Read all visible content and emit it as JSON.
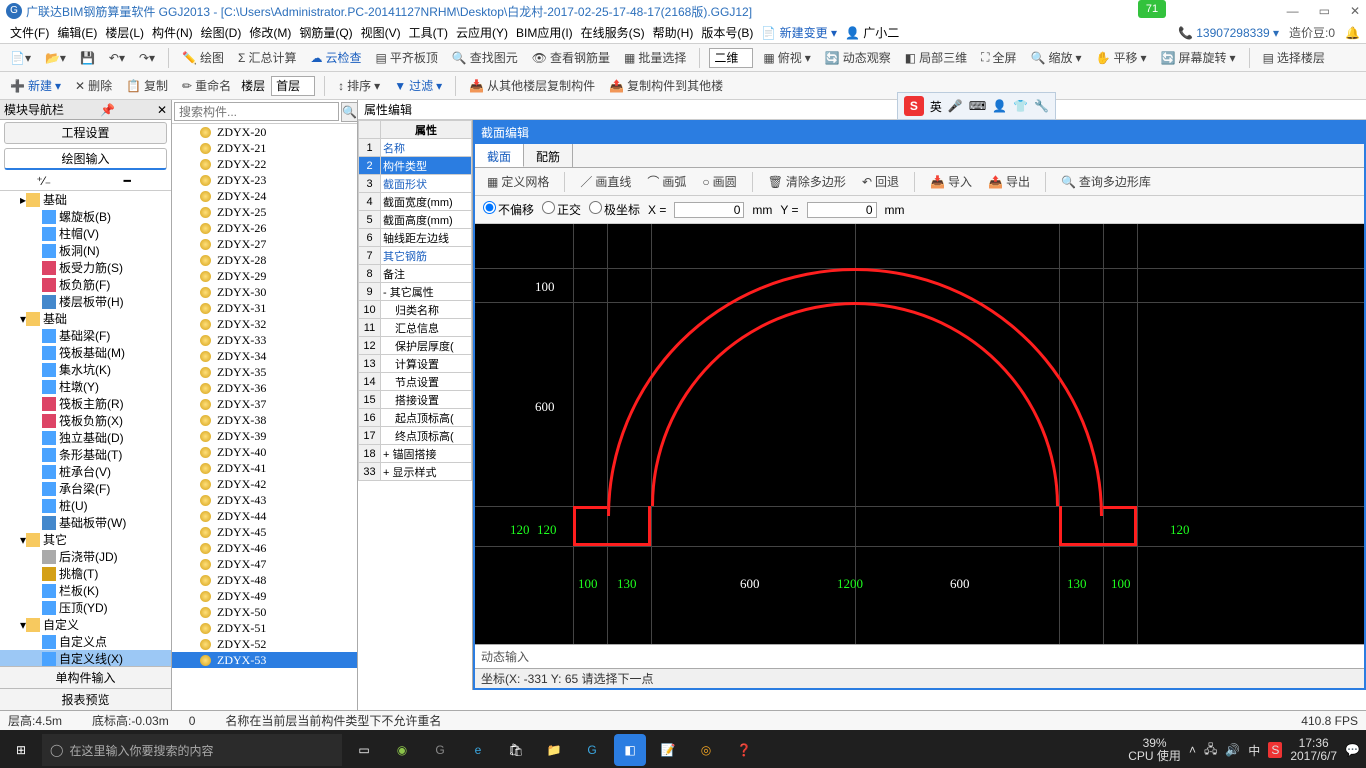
{
  "title": "广联达BIM钢筋算量软件 GGJ2013 - [C:\\Users\\Administrator.PC-20141127NRHM\\Desktop\\白龙村-2017-02-25-17-48-17(2168版).GGJ12]",
  "badge_num": "71",
  "menu": [
    "文件(F)",
    "编辑(E)",
    "楼层(L)",
    "构件(N)",
    "绘图(D)",
    "修改(M)",
    "钢筋量(Q)",
    "视图(V)",
    "工具(T)",
    "云应用(Y)",
    "BIM应用(I)",
    "在线服务(S)",
    "帮助(H)",
    "版本号(B)"
  ],
  "menu_right": {
    "new_change": "新建变更",
    "user": "广小二",
    "phone": "13907298339",
    "beans": "造价豆:0"
  },
  "toolbar1": [
    "绘图",
    "汇总计算",
    "云检查",
    "平齐板顶",
    "查找图元",
    "查看钢筋量",
    "批量选择",
    "二维",
    "俯视",
    "动态观察",
    "局部三维",
    "全屏",
    "缩放",
    "平移",
    "屏幕旋转",
    "选择楼层"
  ],
  "toolbar2": {
    "new": "新建",
    "del": "删除",
    "copy": "复制",
    "rename": "重命名",
    "floor_lbl": "楼层",
    "floor": "首层",
    "sort": "排序",
    "filter": "过滤",
    "copy_from": "从其他楼层复制构件",
    "copy_to": "复制构件到其他楼"
  },
  "sogou": "英",
  "nav_header": "模块导航栏",
  "nav_tab1": "工程设置",
  "nav_tab2": "绘图输入",
  "tree_groups": [
    {
      "label": "基础",
      "children": [
        {
          "l": "螺旋板(B)",
          "c": "#4aa3ff"
        },
        {
          "l": "柱帽(V)",
          "c": "#4aa3ff"
        },
        {
          "l": "板洞(N)",
          "c": "#4aa3ff"
        },
        {
          "l": "板受力筋(S)",
          "c": "#d46"
        },
        {
          "l": "板负筋(F)",
          "c": "#d46"
        },
        {
          "l": "楼层板带(H)",
          "c": "#48c"
        }
      ]
    },
    {
      "label": "基础",
      "open": true,
      "children": [
        {
          "l": "基础梁(F)",
          "c": "#4aa3ff"
        },
        {
          "l": "筏板基础(M)",
          "c": "#4aa3ff"
        },
        {
          "l": "集水坑(K)",
          "c": "#4aa3ff"
        },
        {
          "l": "柱墩(Y)",
          "c": "#4aa3ff"
        },
        {
          "l": "筏板主筋(R)",
          "c": "#d46"
        },
        {
          "l": "筏板负筋(X)",
          "c": "#d46"
        },
        {
          "l": "独立基础(D)",
          "c": "#4aa3ff"
        },
        {
          "l": "条形基础(T)",
          "c": "#4aa3ff"
        },
        {
          "l": "桩承台(V)",
          "c": "#4aa3ff"
        },
        {
          "l": "承台梁(F)",
          "c": "#4aa3ff"
        },
        {
          "l": "桩(U)",
          "c": "#4aa3ff"
        },
        {
          "l": "基础板带(W)",
          "c": "#48c"
        }
      ]
    },
    {
      "label": "其它",
      "open": true,
      "children": [
        {
          "l": "后浇带(JD)",
          "c": "#aaa"
        },
        {
          "l": "挑檐(T)",
          "c": "#d4a017"
        },
        {
          "l": "栏板(K)",
          "c": "#4aa3ff"
        },
        {
          "l": "压顶(YD)",
          "c": "#4aa3ff"
        }
      ]
    },
    {
      "label": "自定义",
      "open": true,
      "children": [
        {
          "l": "自定义点",
          "c": "#4aa3ff"
        },
        {
          "l": "自定义线(X)",
          "c": "#4aa3ff",
          "sel": true
        },
        {
          "l": "自定义面",
          "c": "#4aa3ff"
        },
        {
          "l": "尺寸标注(W)",
          "c": "#4aa3ff"
        }
      ]
    }
  ],
  "left_bottom": [
    "单构件输入",
    "报表预览"
  ],
  "search_placeholder": "搜索构件...",
  "component_list_start": 20,
  "component_list_end": 53,
  "component_prefix": "ZDYX-",
  "component_selected": "ZDYX-53",
  "prop_header": "属性编辑",
  "prop_col": "属性",
  "prop_rows": [
    {
      "n": 1,
      "l": "名称",
      "lnk": true
    },
    {
      "n": 2,
      "l": "构件类型",
      "sel": true
    },
    {
      "n": 3,
      "l": "截面形状",
      "lnk": true
    },
    {
      "n": 4,
      "l": "截面宽度(mm)"
    },
    {
      "n": 5,
      "l": "截面高度(mm)"
    },
    {
      "n": 6,
      "l": "轴线距左边线"
    },
    {
      "n": 7,
      "l": "其它钢筋",
      "lnk": true
    },
    {
      "n": 8,
      "l": "备注"
    },
    {
      "n": 9,
      "l": "其它属性",
      "exp": "-"
    },
    {
      "n": 10,
      "l": "归类名称",
      "ind": true
    },
    {
      "n": 11,
      "l": "汇总信息",
      "ind": true
    },
    {
      "n": 12,
      "l": "保护层厚度(",
      "ind": true
    },
    {
      "n": 13,
      "l": "计算设置",
      "ind": true
    },
    {
      "n": 14,
      "l": "节点设置",
      "ind": true
    },
    {
      "n": 15,
      "l": "搭接设置",
      "ind": true
    },
    {
      "n": 16,
      "l": "起点顶标高(",
      "ind": true
    },
    {
      "n": 17,
      "l": "终点顶标高(",
      "ind": true
    },
    {
      "n": 18,
      "l": "锚固搭接",
      "exp": "+"
    },
    {
      "n": 33,
      "l": "显示样式",
      "exp": "+"
    }
  ],
  "section_editor": {
    "title": "截面编辑",
    "tabs": [
      "截面",
      "配筋"
    ],
    "tb1": [
      "定义网格",
      "画直线",
      "画弧",
      "画圆",
      "清除多边形",
      "回退",
      "导入",
      "导出",
      "查询多边形库"
    ],
    "tb2": {
      "opts": [
        "不偏移",
        "正交",
        "极坐标"
      ],
      "sel": "不偏移",
      "x_lbl": "X =",
      "x": "0",
      "y_lbl": "Y =",
      "y": "0",
      "unit": "mm"
    },
    "dyn": "动态输入",
    "coord": "坐标(X: -331 Y: 65 请选择下一点"
  },
  "chart_data": {
    "type": "diagram",
    "dims": {
      "top": "100",
      "left_h": "600",
      "base_l": "100",
      "base_l2": "130",
      "span_l": "600",
      "center": "1200",
      "span_r": "600",
      "base_r2": "130",
      "base_r": "100",
      "foot_h_l": "120",
      "foot_h_r": "120",
      "foot_h_l2": "120"
    }
  },
  "status": {
    "floor_h": "层高:4.5m",
    "bottom_h": "底标高:-0.03m",
    "zero": "0",
    "msg": "名称在当前层当前构件类型下不允许重名",
    "fps": "410.8 FPS"
  },
  "taskbar": {
    "search": "在这里输入你要搜索的内容",
    "cpu_pct": "39%",
    "cpu_lbl": "CPU 使用",
    "ime": "中",
    "time": "17:36",
    "date": "2017/6/7"
  }
}
